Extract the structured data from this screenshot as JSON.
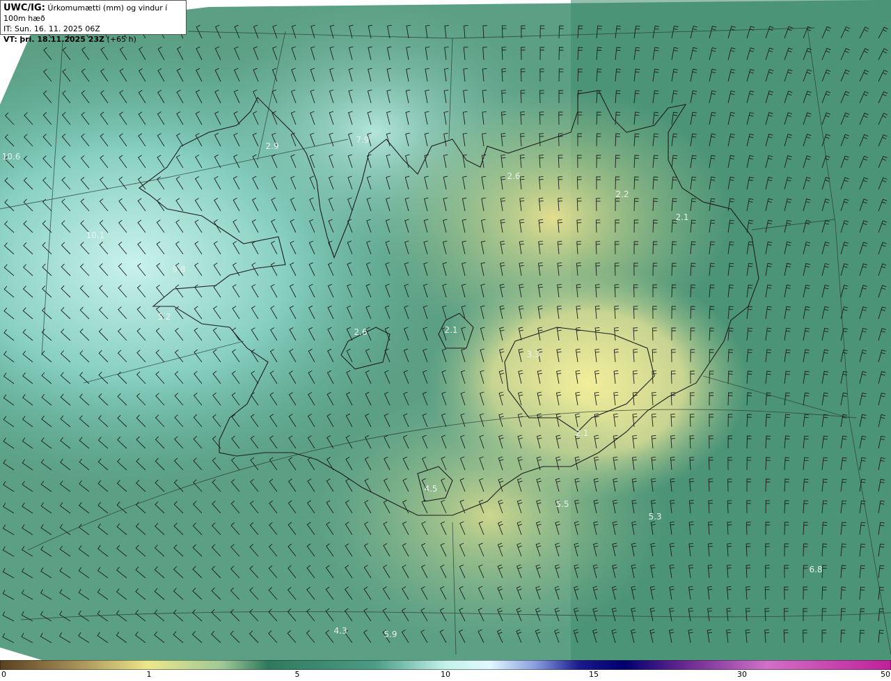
{
  "header": {
    "model": "UWC/IG:",
    "title": "Úrkomumætti (mm) og vindur í 100m hæð",
    "init_time": "IT: Sun. 16. 11. 2025 06Z",
    "valid_label": "VT:",
    "valid_date": "þri. 18.11.2025 23Z",
    "valid_offset": "(+65 h)"
  },
  "map_values": [
    "10.6",
    "10.1",
    "9.8",
    "5.2",
    "2.9",
    "7.9",
    "2.6",
    "2.2",
    "2.1",
    "2.6",
    "2.1",
    "3.3",
    "2.1",
    "4.5",
    "5.5",
    "5.3",
    "6.8",
    "4.3",
    "5.9"
  ],
  "colorbar": {
    "ticks": [
      "0",
      "1",
      "5",
      "10",
      "15",
      "30",
      "50"
    ],
    "colors": [
      "#5a4020",
      "#a08a52",
      "#ece78c",
      "#9ec896",
      "#2f7a5e",
      "#4a9c84",
      "#c2f2ea",
      "#e0f8ff",
      "#8aa0e0",
      "#1a1a8c",
      "#000070",
      "#6a2a90",
      "#d070c8",
      "#c0209a"
    ]
  }
}
